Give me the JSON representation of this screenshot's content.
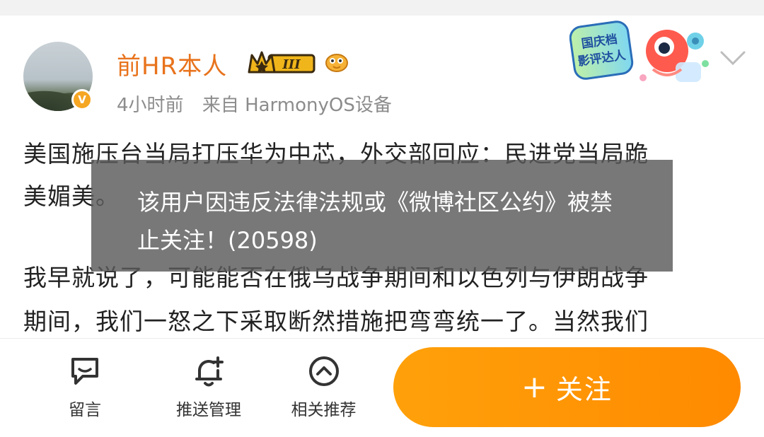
{
  "post": {
    "author": {
      "name": "前HR本人",
      "level_badge": "III",
      "time": "4小时前",
      "source": "来自 HarmonyOS设备"
    },
    "event_badge": "国庆档影评达人",
    "lines": [
      "美国施压台当局打压华为中芯，外交部回应：民进党当局跪",
      "美媚美。",
      "我早就说了，可能能否在俄乌战争期间和以色列与伊朗战争",
      "期间，我们一怒之下采取断然措施把弯弯统一了。当然我们"
    ]
  },
  "toast": {
    "message": "该用户因违反法律法规或《微博社区公约》被禁止关注！(20598)"
  },
  "bottom_bar": {
    "comment_label": "留言",
    "push_label": "推送管理",
    "recommend_label": "相关推荐",
    "follow_label": "关注",
    "follow_plus": "+"
  },
  "colors": {
    "username": "#e8731c",
    "follow_button": "#ff9500",
    "toast_bg": "#5a5a5a"
  }
}
